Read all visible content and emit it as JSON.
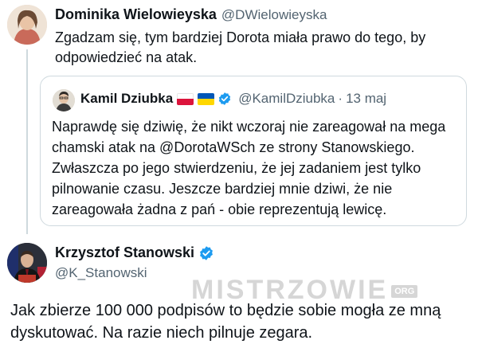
{
  "tweet1": {
    "author_name": "Dominika Wielowieyska",
    "author_handle": "@DWielowieyska",
    "text": "Zgadzam się, tym bardziej Dorota miała prawo do tego, by odpowiedzieć na atak."
  },
  "quote": {
    "author_name": "Kamil Dziubka",
    "author_handle": "@KamilDziubka",
    "date": "13 maj",
    "flags": [
      "flag-poland",
      "flag-ukraine"
    ],
    "text": "Naprawdę się dziwię, że nikt wczoraj nie zareagował na mega chamski atak na @DorotaWSch ze strony Stanowskiego. Zwłaszcza po jego stwierdzeniu, że jej zadaniem jest tylko pilnowanie czasu. Jeszcze bardziej mnie dziwi, że nie zareagowała żadna z pań - obie reprezentują lewicę."
  },
  "tweet3": {
    "author_name": "Krzysztof Stanowski",
    "author_handle": "@K_Stanowski",
    "text": "Jak zbierze 100 000 podpisów to będzie sobie mogła ze mną dyskutować. Na razie niech pilnuje zegara."
  },
  "watermark": {
    "text": "MISTRZOWIE",
    "suffix": "ORG"
  },
  "colors": {
    "verified": "#1d9bf0",
    "secondary_text": "#536471",
    "border": "#cfd9de"
  }
}
